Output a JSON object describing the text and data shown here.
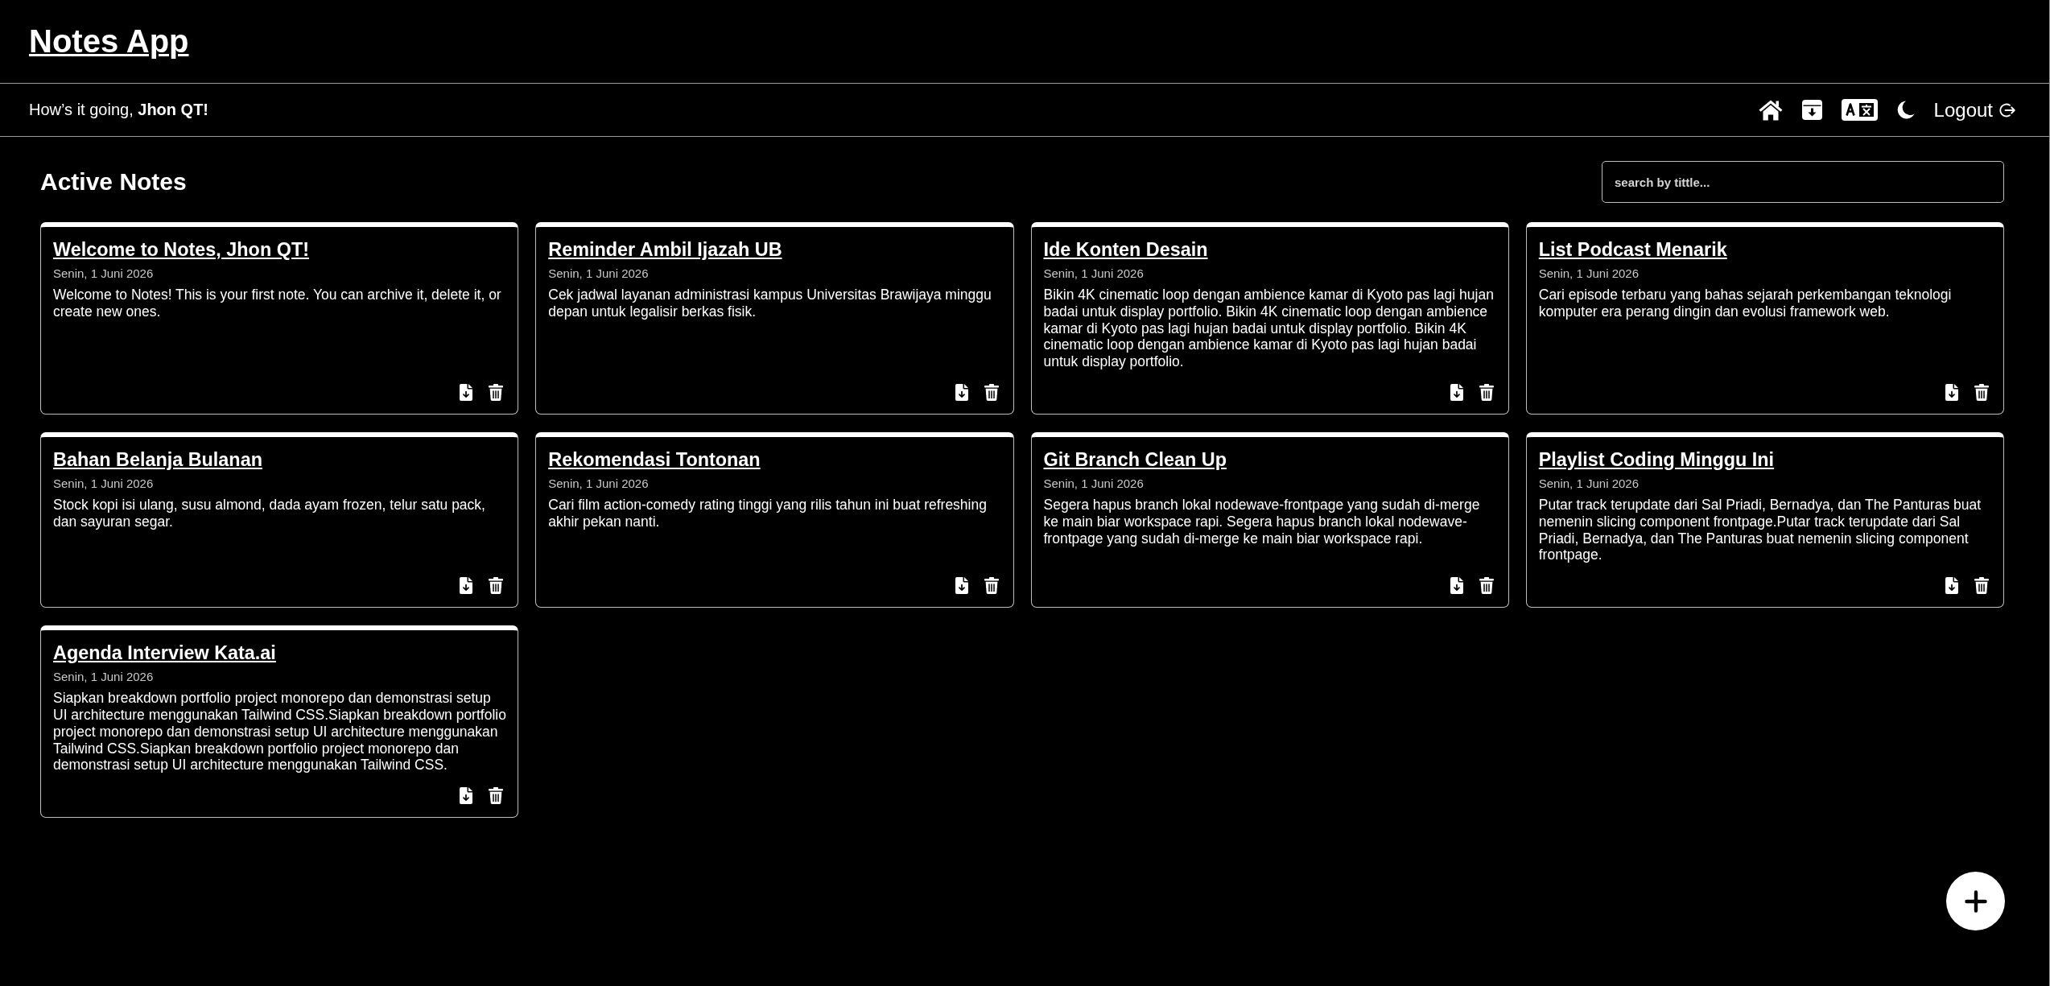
{
  "header": {
    "title": "Notes App"
  },
  "navbar": {
    "greeting": "How’s it going, **Jhon QT!**",
    "logout": "Logout"
  },
  "main": {
    "heading": "Active Notes",
    "search": {
      "placeholder": "search by tittle..."
    },
    "notes": [
      {
        "title": "Welcome to Notes, Jhon QT!",
        "date": "Senin, 1 Juni 2026",
        "body": "Welcome to Notes! This is your first note. You can archive it, delete it, or create new ones."
      },
      {
        "title": "Reminder Ambil Ijazah UB",
        "date": "Senin, 1 Juni 2026",
        "body": "Cek jadwal layanan administrasi kampus Universitas Brawijaya minggu depan untuk legalisir berkas fisik."
      },
      {
        "title": "Ide Konten Desain",
        "date": "Senin, 1 Juni 2026",
        "body": "Bikin 4K cinematic loop dengan ambience kamar di Kyoto pas lagi hujan badai untuk display portfolio. Bikin 4K cinematic loop dengan ambience kamar di Kyoto pas lagi hujan badai untuk display portfolio. Bikin 4K cinematic loop dengan ambience kamar di Kyoto pas lagi hujan badai untuk display portfolio."
      },
      {
        "title": "List Podcast Menarik",
        "date": "Senin, 1 Juni 2026",
        "body": "Cari episode terbaru yang bahas sejarah perkembangan teknologi komputer era perang dingin dan evolusi framework web."
      },
      {
        "title": "Bahan Belanja Bulanan",
        "date": "Senin, 1 Juni 2026",
        "body": "Stock kopi isi ulang, susu almond, dada ayam frozen, telur satu pack, dan sayuran segar."
      },
      {
        "title": "Rekomendasi Tontonan",
        "date": "Senin, 1 Juni 2026",
        "body": "Cari film action-comedy rating tinggi yang rilis tahun ini buat refreshing akhir pekan nanti."
      },
      {
        "title": "Git Branch Clean Up",
        "date": "Senin, 1 Juni 2026",
        "body": "Segera hapus branch lokal nodewave-frontpage yang sudah di-merge ke main biar workspace rapi. Segera hapus branch lokal nodewave-frontpage yang sudah di-merge ke main biar workspace rapi."
      },
      {
        "title": "Playlist Coding Minggu Ini",
        "date": "Senin, 1 Juni 2026",
        "body": "Putar track terupdate dari Sal Priadi, Bernadya, dan The Panturas buat nemenin slicing component frontpage.Putar track terupdate dari Sal Priadi, Bernadya, dan The Panturas buat nemenin slicing component frontpage."
      },
      {
        "title": "Agenda Interview Kata.ai",
        "date": "Senin, 1 Juni 2026",
        "body": "Siapkan breakdown portfolio project monorepo dan demonstrasi setup UI architecture menggunakan Tailwind CSS.Siapkan breakdown portfolio project monorepo dan demonstrasi setup UI architecture menggunakan Tailwind CSS.Siapkan breakdown portfolio project monorepo dan demonstrasi setup UI architecture menggunakan Tailwind CSS."
      }
    ]
  }
}
